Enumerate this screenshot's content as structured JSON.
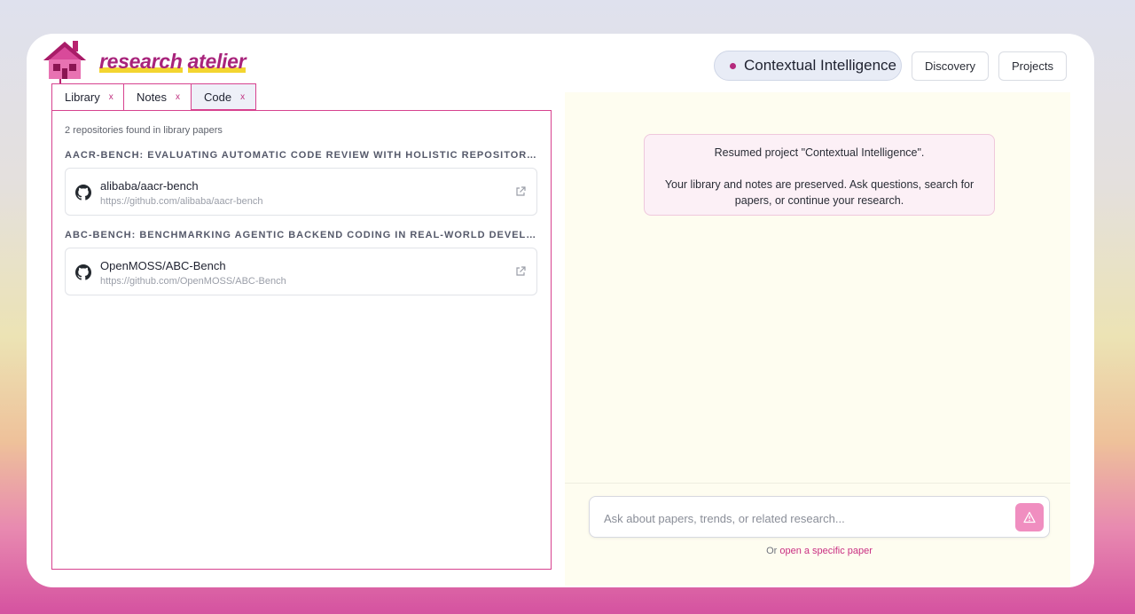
{
  "brand": {
    "word1": "research",
    "word2": "atelier"
  },
  "header": {
    "project_name": "Contextual Intelligence",
    "discovery_label": "Discovery",
    "projects_label": "Projects"
  },
  "tabs": [
    {
      "label": "Library",
      "close": "x"
    },
    {
      "label": "Notes",
      "close": "x"
    },
    {
      "label": "Code",
      "close": "x",
      "active": true
    }
  ],
  "code_panel": {
    "count_text": "2 repositories found in library papers",
    "papers": [
      {
        "title": "AACR-BENCH: EVALUATING AUTOMATIC CODE REVIEW WITH HOLISTIC REPOSITORY-LEVE...",
        "repo_name": "alibaba/aacr-bench",
        "repo_url": "https://github.com/alibaba/aacr-bench"
      },
      {
        "title": "ABC-BENCH: BENCHMARKING AGENTIC BACKEND CODING IN REAL-WORLD DEVELOPMENT",
        "repo_name": "OpenMOSS/ABC-Bench",
        "repo_url": "https://github.com/OpenMOSS/ABC-Bench"
      }
    ]
  },
  "chat": {
    "message_line1": "Resumed project \"Contextual Intelligence\".",
    "message_line2": "Your library and notes are preserved. Ask questions, search for papers, or continue your research.",
    "input_placeholder": "Ask about papers, trends, or related research...",
    "hint_prefix": "Or",
    "hint_link": "open a specific paper"
  },
  "icons": {
    "logo": "house-icon",
    "repo": "github-icon",
    "external": "external-link-icon",
    "send": "warning-triangle-icon"
  },
  "colors": {
    "accent": "#d7428f",
    "brand": "#a8237b",
    "highlight": "#f3d530",
    "send_button": "#f08ec0"
  }
}
